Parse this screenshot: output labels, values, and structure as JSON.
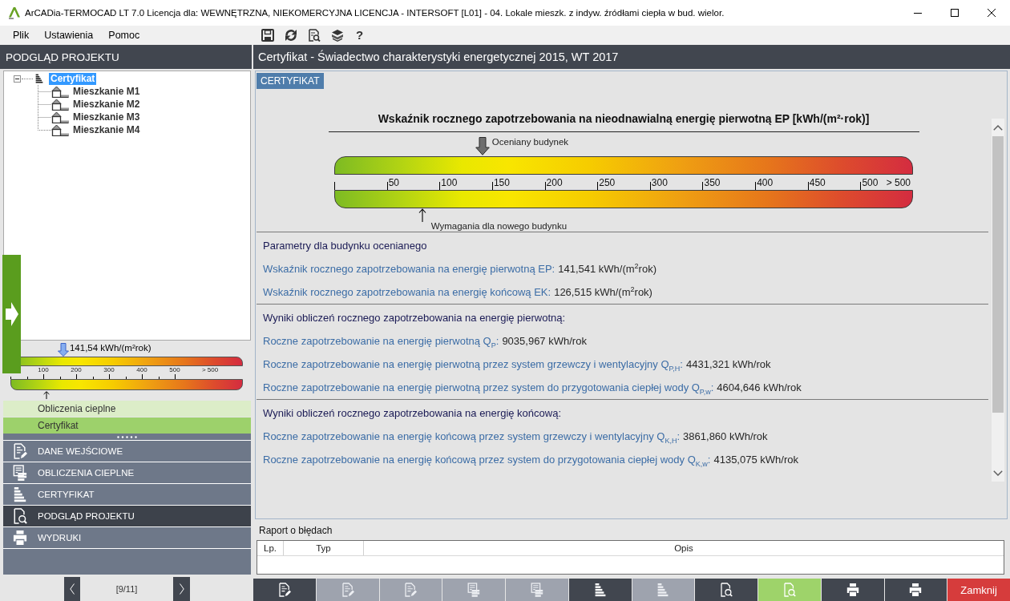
{
  "window": {
    "title": "ArCADia-TERMOCAD LT 7.0 Licencja dla: WEWNĘTRZNA, NIEKOMERCYJNA LICENCJA - INTERSOFT [L01] - 04. Lokale mieszk. z indyw. źródłami ciepła w bud. wielor."
  },
  "menu": [
    "Plik",
    "Ustawienia",
    "Pomoc"
  ],
  "toolbar": [
    {
      "kind": "save"
    },
    {
      "kind": "refresh"
    },
    {
      "kind": "preview"
    },
    {
      "kind": "stack"
    },
    {
      "kind": "help",
      "label": "?"
    }
  ],
  "left_panel": {
    "title": "PODGLĄD PROJEKTU",
    "tree": [
      {
        "label": "Certyfikat",
        "selected": true,
        "expanded": true,
        "children": [
          {
            "label": "Mieszkanie M1",
            "selected": false
          },
          {
            "label": "Mieszkanie M2",
            "selected": false
          },
          {
            "label": "Mieszkanie M3",
            "selected": false
          },
          {
            "label": "Mieszkanie M4",
            "selected": false
          }
        ]
      }
    ],
    "mini_scale": {
      "marker": {
        "label": "141,54 kWh/(m²rok)",
        "level": 0.224
      },
      "reference": {
        "level": 0.152
      },
      "labels": [
        {
          "label": "100",
          "kind": "tick"
        },
        {
          "label": "200",
          "kind": "tick"
        },
        {
          "label": "300",
          "kind": "tick"
        },
        {
          "label": "400",
          "kind": "tick"
        },
        {
          "label": "500",
          "kind": "tick"
        },
        {
          "label": "> 500",
          "kind": "overflow"
        }
      ]
    },
    "steps": [
      {
        "label": "Obliczenia cieplne",
        "selected": false
      },
      {
        "label": "Certyfikat",
        "selected": true
      }
    ],
    "nav": [
      {
        "label": "DANE WEJŚCIOWE",
        "kind": "edit",
        "selected": false
      },
      {
        "label": "OBLICZENIA CIEPLNE",
        "kind": "table",
        "selected": false
      },
      {
        "label": "CERTYFIKAT",
        "kind": "levels",
        "selected": false
      },
      {
        "label": "PODGLĄD PROJEKTU",
        "kind": "preview",
        "selected": true
      },
      {
        "label": "WYDRUKI",
        "kind": "print",
        "selected": false
      }
    ],
    "pager": {
      "text": "[9/11]"
    }
  },
  "content": {
    "title": "Certyfikat - Świadectwo charakterystyki energetycznej 2015, WT 2017",
    "tabs": [
      {
        "label": "CERTYFIKAT",
        "selected": true
      }
    ],
    "scale": {
      "title": "Wskaźnik rocznego zapotrzebowania na nieodnawialną energię pierwotną EP [kWh/(m²·rok)]",
      "marker": {
        "label": "Oceniany budynek",
        "level": 0.256
      },
      "reference": {
        "label": "Wymagania dla nowego budynku",
        "level": 0.152
      },
      "labels": [
        {
          "label": "50",
          "kind": "tick"
        },
        {
          "label": "100",
          "kind": "tick"
        },
        {
          "label": "150",
          "kind": "tick"
        },
        {
          "label": "200",
          "kind": "tick"
        },
        {
          "label": "250",
          "kind": "tick"
        },
        {
          "label": "300",
          "kind": "tick"
        },
        {
          "label": "350",
          "kind": "tick"
        },
        {
          "label": "400",
          "kind": "tick"
        },
        {
          "label": "450",
          "kind": "tick"
        },
        {
          "label": "500",
          "kind": "tick"
        },
        {
          "label": "> 500",
          "kind": "overflow"
        }
      ]
    },
    "sections": [
      {
        "heading": "Parametry dla budynku ocenianego",
        "rows": [
          {
            "label": "Wskaźnik rocznego zapotrzebowania na energię pierwotną EP:",
            "value": "141,541 kWh/(m$^{2}$rok)"
          },
          {
            "label": "Wskaźnik rocznego zapotrzebowania na energię końcową EK:",
            "value": "126,515 kWh/(m$^{2}$rok)"
          }
        ]
      },
      {
        "heading": "Wyniki obliczeń rocznego zapotrzebowania na energię pierwotną:",
        "rows": [
          {
            "label": "Roczne zapotrzebowanie na energię pierwotną Q$_{P}$:",
            "value": "9035,967 kWh/rok"
          },
          {
            "label": "Roczne zapotrzebowanie na energię pierwotną przez system grzewczy i wentylacyjny Q$_{P,H}$:",
            "value": "4431,321 kWh/rok"
          },
          {
            "label": "Roczne zapotrzebowanie na energię pierwotną przez system do przygotowania ciepłej wody Q$_{P,w}$:",
            "value": "4604,646 kWh/rok"
          }
        ]
      },
      {
        "heading": "Wyniki obliczeń rocznego zapotrzebowania na energię końcową:",
        "rows": [
          {
            "label": "Roczne zapotrzebowanie na energię końcową przez system grzewczy i wentylacyjny Q$_{K,H}$:",
            "value": "3861,860 kWh/rok"
          },
          {
            "label": "Roczne zapotrzebowanie na energię końcową przez system do przygotowania ciepłej wody Q$_{K,w}$:",
            "value": "4135,075 kWh/rok"
          }
        ]
      }
    ]
  },
  "error_report": {
    "title": "Raport o błędach",
    "columns": [
      "Lp.",
      "Typ",
      "Opis"
    ]
  },
  "bottom_toolbar": [
    {
      "kind": "edit",
      "disabled": false,
      "selected": false
    },
    {
      "kind": "edit",
      "disabled": true,
      "selected": false
    },
    {
      "kind": "edit",
      "disabled": true,
      "selected": false
    },
    {
      "kind": "table",
      "disabled": true,
      "selected": false
    },
    {
      "kind": "table",
      "disabled": true,
      "selected": false
    },
    {
      "kind": "levels",
      "disabled": false,
      "selected": false
    },
    {
      "kind": "levels",
      "disabled": true,
      "selected": false
    },
    {
      "kind": "preview",
      "disabled": false,
      "selected": false
    },
    {
      "kind": "preview",
      "disabled": false,
      "selected": true
    },
    {
      "kind": "print",
      "disabled": false,
      "selected": false
    },
    {
      "kind": "print",
      "disabled": false,
      "selected": false
    },
    {
      "kind": "close",
      "label": "Zamknij",
      "disabled": false,
      "selected": false
    }
  ]
}
